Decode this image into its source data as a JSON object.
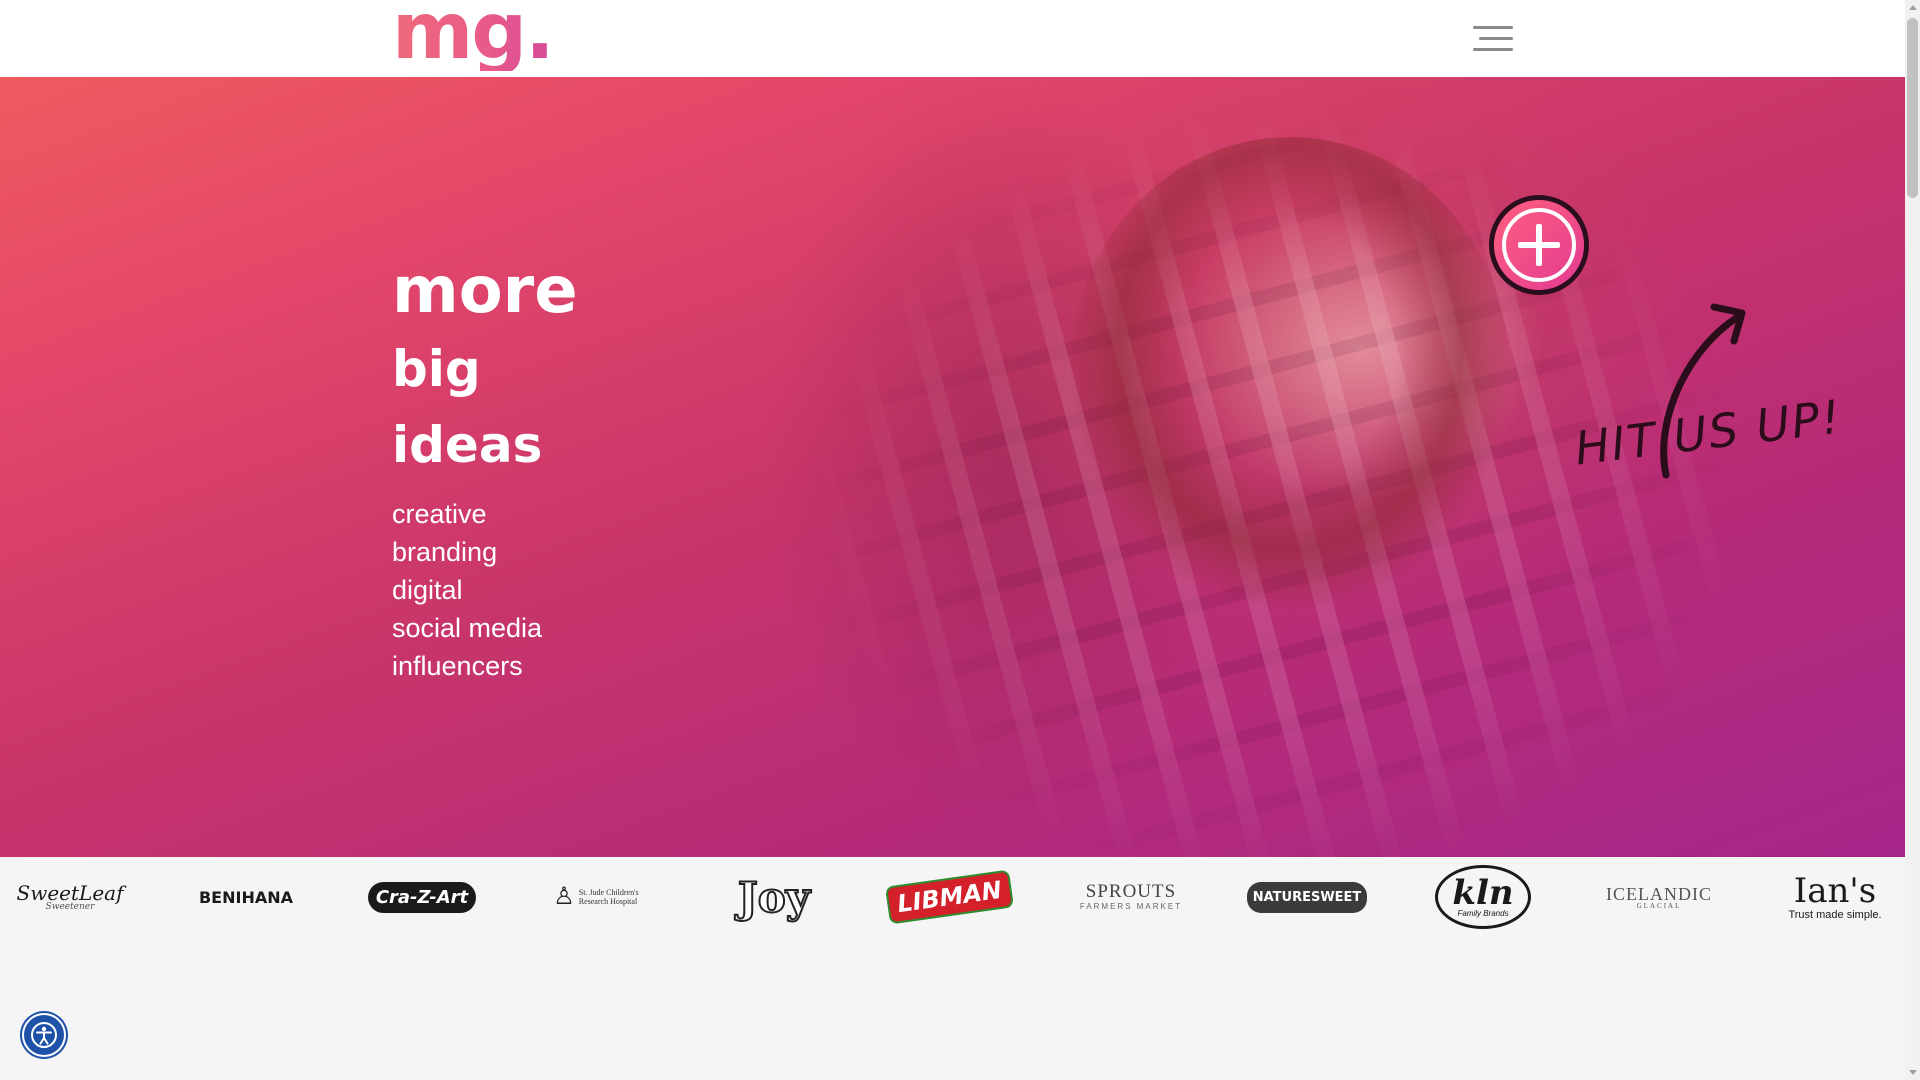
{
  "header": {
    "logo_text": "mg.",
    "menu_icon": "hamburger-menu-icon"
  },
  "hero": {
    "headline": [
      "more",
      "big",
      "ideas"
    ],
    "services": [
      "creative",
      "branding",
      "digital",
      "social media",
      "influencers"
    ],
    "cta_icon": "plus-circle-icon",
    "cta_text": "HIT US UP!"
  },
  "clients": [
    {
      "name": "SweetLeaf",
      "sub": "Sweetener"
    },
    {
      "name": "BENIHANA"
    },
    {
      "name": "Cra-Z-Art"
    },
    {
      "name": "St. Jude Children's Research Hospital"
    },
    {
      "name": "Joy"
    },
    {
      "name": "LIBMAN"
    },
    {
      "name": "SPROUTS",
      "sub": "FARMERS MARKET"
    },
    {
      "name": "NATURESWEET"
    },
    {
      "name": "kln",
      "sub": "Family Brands"
    },
    {
      "name": "ICELANDIC",
      "sub": "GLACIAL"
    },
    {
      "name": "Ian's",
      "sub": "Trust made simple."
    }
  ],
  "accessibility": {
    "icon": "accessibility-person-icon"
  },
  "colors": {
    "brand": "#e85a8a",
    "hero_start": "#ef5a5f",
    "hero_end": "#a5268a",
    "a11y": "#1d52a8"
  }
}
